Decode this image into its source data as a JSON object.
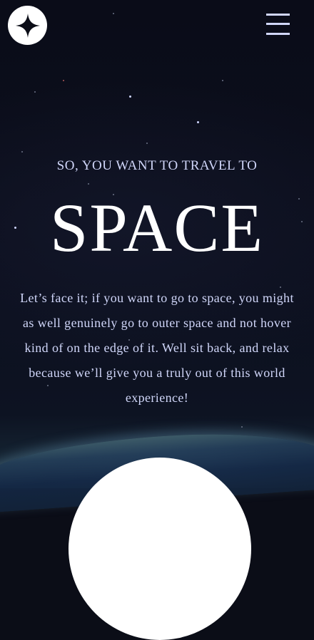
{
  "header": {
    "logo_icon": "four-point-star-icon",
    "menu_icon": "hamburger-menu-icon"
  },
  "hero": {
    "subtitle": "SO, YOU WANT TO TRAVEL TO",
    "title": "SPACE",
    "description": "Let’s face it; if you want to go to space, you might as well genuinely go to outer space and not hover kind of on the edge of it. Well sit back, and relax because we’ll give you a truly out of this world experience!"
  },
  "explore_button": {
    "shape": "circle",
    "color": "#ffffff"
  },
  "colors": {
    "background": "#0b0d17",
    "accent_text": "#d0d6f9",
    "primary_text": "#ffffff"
  }
}
